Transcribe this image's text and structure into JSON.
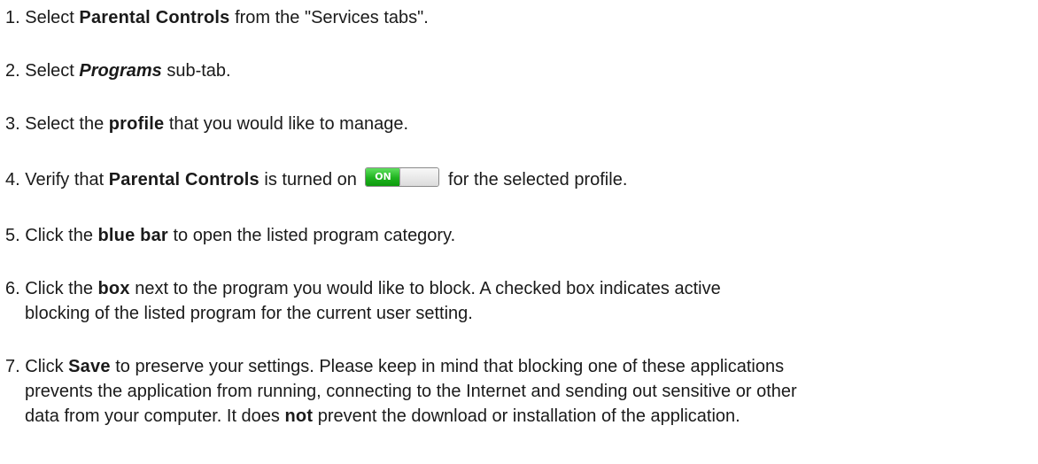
{
  "steps": {
    "s1": {
      "num": "1. ",
      "a": "Select ",
      "b": "Parental Controls",
      "c": " from the \"Services tabs\"."
    },
    "s2": {
      "num": "2. ",
      "a": "Select ",
      "b": "Programs",
      "c": " sub-tab."
    },
    "s3": {
      "num": "3. ",
      "a": "Select the ",
      "b": "profile",
      "c": " that you would like to manage."
    },
    "s4": {
      "num": "4. ",
      "a": "Verify that ",
      "b": "Parental Controls",
      "c": " is turned on ",
      "toggle_label": "ON",
      "d": " for the selected profile."
    },
    "s5": {
      "num": "5. ",
      "a": "Click the ",
      "b": "blue bar",
      "c": " to open the listed program category."
    },
    "s6": {
      "num": "6. ",
      "a": "Click the ",
      "b": "box",
      "c": " next to the program you would like to block. A checked box indicates active",
      "line2": "blocking of the listed program for the current user setting."
    },
    "s7": {
      "num": "7. ",
      "a": "Click ",
      "b": "Save",
      "c": " to preserve your settings. Please keep in mind that blocking one of these applications",
      "line2": "prevents the application from running, connecting to the Internet and sending out sensitive or other",
      "line3a": "data from your computer. It does ",
      "line3b": "not",
      "line3c": " prevent the download or installation of the application."
    }
  },
  "colors": {
    "toggle_on": "#1fb31f",
    "text": "#1a1a1a"
  }
}
